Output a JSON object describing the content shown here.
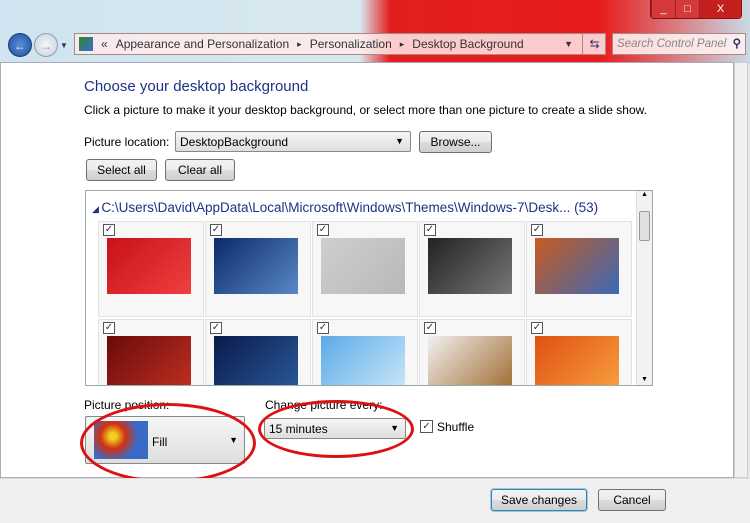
{
  "window": {
    "minimize": "_",
    "maximize": "□",
    "close": "X"
  },
  "address": {
    "chevron": "«",
    "crumbs": [
      "Appearance and Personalization",
      "Personalization",
      "Desktop Background"
    ],
    "separator": "▸",
    "search_placeholder": "Search Control Panel"
  },
  "main": {
    "title": "Choose your desktop background",
    "description": "Click a picture to make it your desktop background, or select more than one picture to create a slide show.",
    "location_label": "Picture location:",
    "location_value": "DesktopBackground",
    "browse": "Browse...",
    "select_all": "Select all",
    "clear_all": "Clear all",
    "gallery_header": "C:\\Users\\David\\AppData\\Local\\Microsoft\\Windows\\Themes\\Windows-7\\Desk... (53)",
    "thumbnails": [
      {
        "checked": true,
        "colors": [
          "#c8101a",
          "#f04040"
        ]
      },
      {
        "checked": true,
        "colors": [
          "#0a2a6a",
          "#5a88c8"
        ]
      },
      {
        "checked": true,
        "colors": [
          "#cfcfcf",
          "#b8b8b8"
        ]
      },
      {
        "checked": true,
        "colors": [
          "#222",
          "#777"
        ]
      },
      {
        "checked": true,
        "colors": [
          "#c85a20",
          "#3a6ab8"
        ]
      },
      {
        "checked": true,
        "colors": [
          "#6a0a0a",
          "#c03020"
        ]
      },
      {
        "checked": true,
        "colors": [
          "#0a1a4a",
          "#2a5a9a"
        ]
      },
      {
        "checked": true,
        "colors": [
          "#5aaae8",
          "#cce8f8"
        ]
      },
      {
        "checked": true,
        "colors": [
          "#f0f0f0",
          "#a06a30"
        ]
      },
      {
        "checked": true,
        "colors": [
          "#e05010",
          "#f8a040"
        ]
      }
    ],
    "position_label": "Picture position:",
    "position_value": "Fill",
    "change_label": "Change picture every:",
    "change_value": "15 minutes",
    "shuffle_label": "Shuffle",
    "shuffle_checked": true
  },
  "footer": {
    "save": "Save changes",
    "cancel": "Cancel"
  }
}
